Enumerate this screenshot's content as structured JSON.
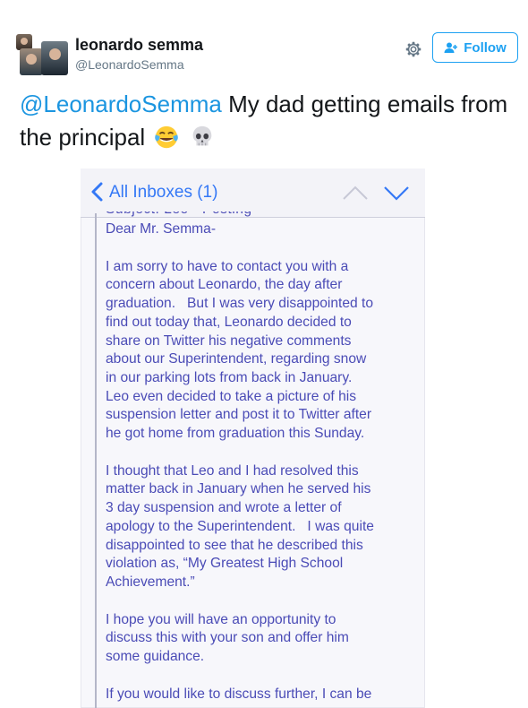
{
  "user": {
    "name": "leonardo semma",
    "handle": "@LeonardoSemma"
  },
  "actions": {
    "follow_label": "Follow"
  },
  "tweet": {
    "mention": "@LeonardoSemma",
    "text": " My dad getting emails from the principal",
    "emojis": [
      "tears-of-joy-emoji",
      "skull-emoji"
    ]
  },
  "screenshot": {
    "header": {
      "inbox_label": "All Inboxes (1)"
    },
    "subject_partial": "Subject: Leo - Posting",
    "greeting": "Dear Mr. Semma-",
    "paragraphs": [
      [
        "I am sorry to have to contact you with a",
        "concern about Leonardo, the day after",
        "graduation.   But I was very disappointed to",
        "find out today that, Leonardo decided to",
        "share on Twitter his negative comments",
        "about our Superintendent, regarding snow",
        "in our parking lots from back in January.",
        "Leo even decided to take a picture of his",
        "suspension letter and post it to Twitter after",
        "he got home from graduation this Sunday."
      ],
      [
        "I thought that Leo and I had resolved this",
        "matter back in January when he served his",
        "3 day suspension and wrote a letter of",
        "apology to the Superintendent.   I was quite",
        "disappointed to see that he described this",
        "violation as, “My Greatest High School",
        "Achievement.”"
      ],
      [
        "I hope you will have an opportunity to",
        "discuss this with your son and offer him",
        "some guidance."
      ],
      [
        "If you would like to discuss further, I can be"
      ]
    ]
  },
  "colors": {
    "link_blue": "#1b95e0",
    "follow_blue": "#1da1f2",
    "ios_blue": "#3478f6",
    "mail_text": "#4a4bb6"
  }
}
